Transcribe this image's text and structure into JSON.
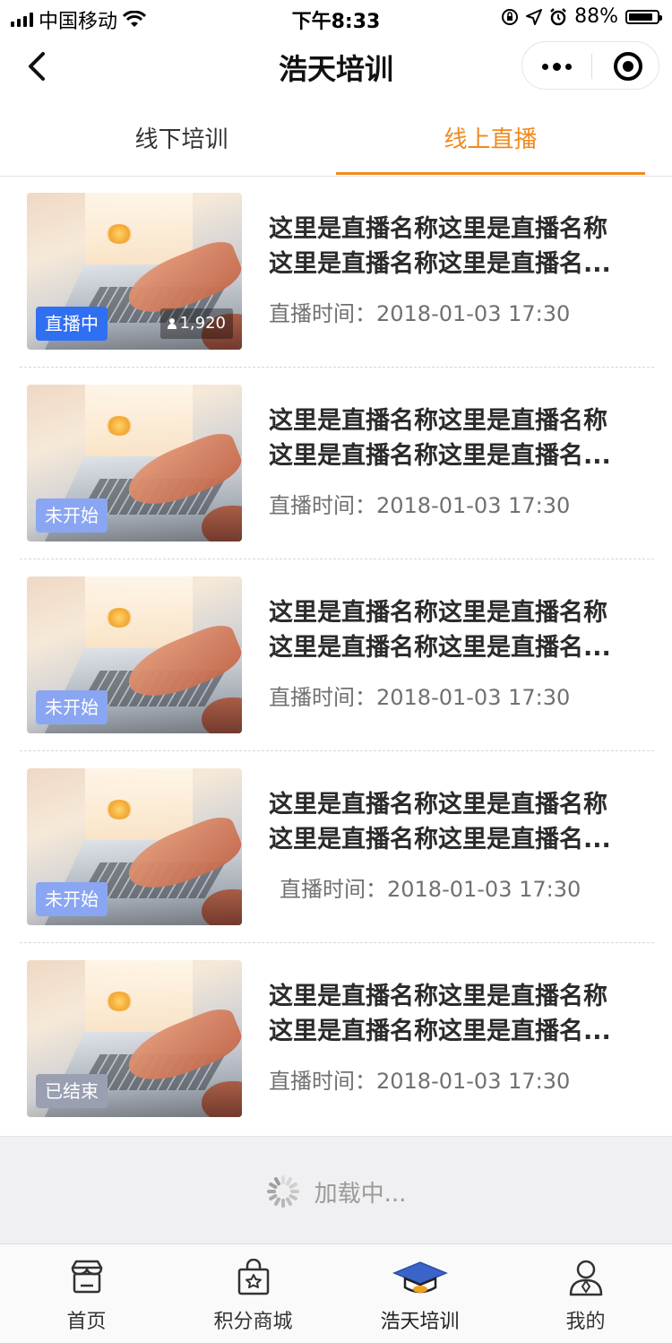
{
  "status_bar": {
    "carrier": "中国移动",
    "time": "下午8:33",
    "battery": "88%",
    "battery_level": 0.88
  },
  "nav": {
    "title": "浩天培训",
    "back_icon": "chevron-left-icon",
    "more_icon": "more-dots-icon",
    "close_icon": "target-circle-icon"
  },
  "tabs": [
    {
      "label": "线下培训",
      "active": false
    },
    {
      "label": "线上直播",
      "active": true
    }
  ],
  "colors": {
    "accent": "#f08a1e",
    "live_badge": "#2f6ff2",
    "pending_badge": "#8aa6f2",
    "ended_badge": "#9aa0b2"
  },
  "items": [
    {
      "badge": "直播中",
      "status": "live",
      "viewers": "1,920",
      "title_line1": "这里是直播名称这里是直播名称",
      "title_line2": "这里是直播名称这里是直播名...",
      "time": "直播时间：2018-01-03 17:30"
    },
    {
      "badge": "未开始",
      "status": "pending",
      "title_line1": "这里是直播名称这里是直播名称",
      "title_line2": "这里是直播名称这里是直播名...",
      "time": "直播时间：2018-01-03 17:30"
    },
    {
      "badge": "未开始",
      "status": "pending",
      "title_line1": "这里是直播名称这里是直播名称",
      "title_line2": "这里是直播名称这里是直播名...",
      "time": "直播时间：2018-01-03 17:30"
    },
    {
      "badge": "未开始",
      "status": "pending",
      "title_line1": "这里是直播名称这里是直播名称",
      "title_line2": "这里是直播名称这里是直播名...",
      "time": "直播时间：2018-01-03 17:30"
    },
    {
      "badge": "已结束",
      "status": "ended",
      "title_line1": "这里是直播名称这里是直播名称",
      "title_line2": "这里是直播名称这里是直播名...",
      "time": "直播时间：2018-01-03 17:30"
    }
  ],
  "loading": {
    "text": "加载中..."
  },
  "tabbar": [
    {
      "label": "首页",
      "icon": "store-icon"
    },
    {
      "label": "积分商城",
      "icon": "shopping-bag-icon"
    },
    {
      "label": "浩天培训",
      "icon": "graduation-cap-icon",
      "active": true
    },
    {
      "label": "我的",
      "icon": "user-icon"
    }
  ]
}
